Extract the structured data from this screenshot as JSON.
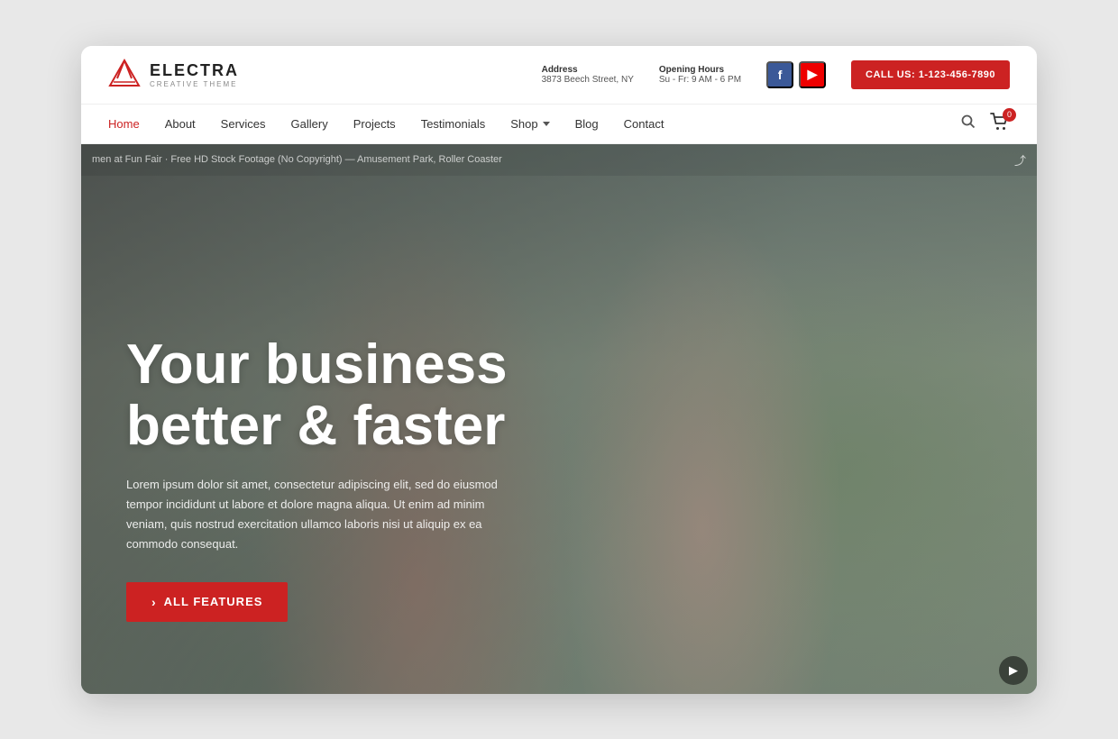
{
  "browser": {
    "shadow": true
  },
  "topbar": {
    "logo_name": "ELECTRA",
    "logo_sub": "CREATIVE THEME",
    "address_label": "Address",
    "address_value": "3873 Beech Street, NY",
    "hours_label": "Opening Hours",
    "hours_value": "Su - Fr: 9 AM - 6 PM",
    "call_label": "CALL US: 1-123-456-7890"
  },
  "nav": {
    "links": [
      {
        "label": "Home",
        "active": true
      },
      {
        "label": "About",
        "active": false
      },
      {
        "label": "Services",
        "active": false
      },
      {
        "label": "Gallery",
        "active": false
      },
      {
        "label": "Projects",
        "active": false
      },
      {
        "label": "Testimonials",
        "active": false
      },
      {
        "label": "Shop",
        "has_dropdown": true,
        "active": false
      },
      {
        "label": "Blog",
        "active": false
      },
      {
        "label": "Contact",
        "active": false
      }
    ],
    "cart_count": "0"
  },
  "hero": {
    "video_bar_text": "men at Fun Fair · Free HD Stock Footage (No Copyright) — Amusement Park, Roller Coaster",
    "title_line1": "Your business",
    "title_line2": "better & faster",
    "description": "Lorem ipsum dolor sit amet, consectetur adipiscing elit, sed do eiusmod tempor incididunt ut labore et dolore magna aliqua. Ut enim ad minim veniam, quis nostrud exercitation ullamco laboris nisi ut aliquip ex ea commodo consequat.",
    "cta_label": "ALL Features",
    "cta_arrow": "›"
  },
  "social": {
    "fb_label": "f",
    "yt_label": "▶"
  }
}
